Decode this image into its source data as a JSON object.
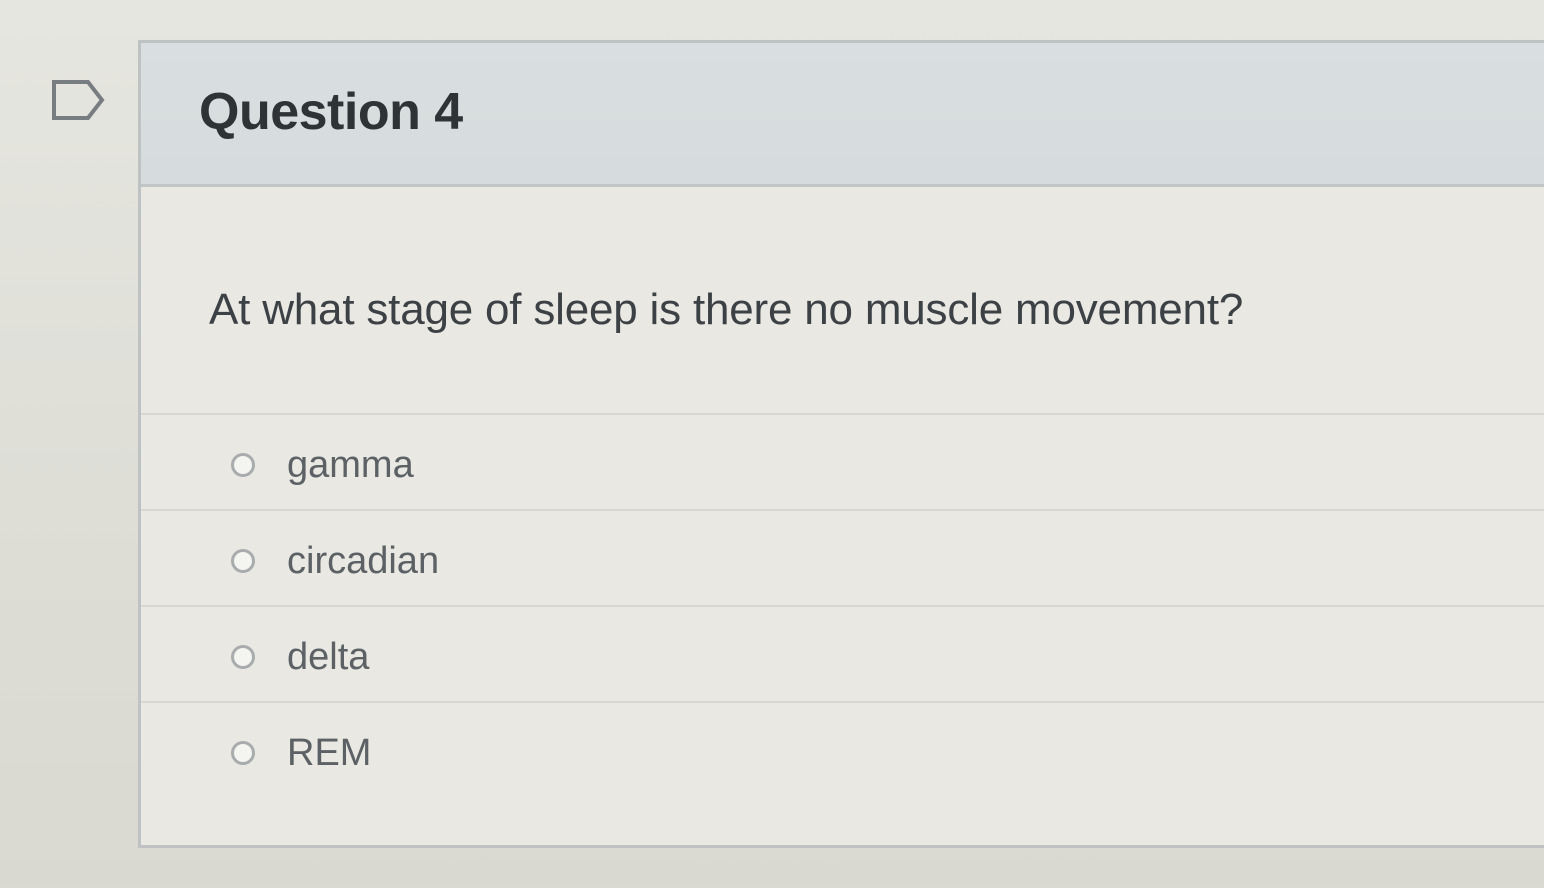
{
  "question": {
    "title": "Question 4",
    "text": "At what stage of sleep is there no muscle movement?",
    "answers": [
      {
        "label": "gamma",
        "selected": false
      },
      {
        "label": "circadian",
        "selected": false
      },
      {
        "label": "delta",
        "selected": false
      },
      {
        "label": "REM",
        "selected": false
      }
    ]
  },
  "icons": {
    "flag": "flag-icon",
    "radio": "radio-button"
  },
  "colors": {
    "header_background": "#d9dfe0",
    "card_background": "#e9e8e2",
    "title_text": "#2f3336",
    "answer_text": "#5b6165"
  }
}
